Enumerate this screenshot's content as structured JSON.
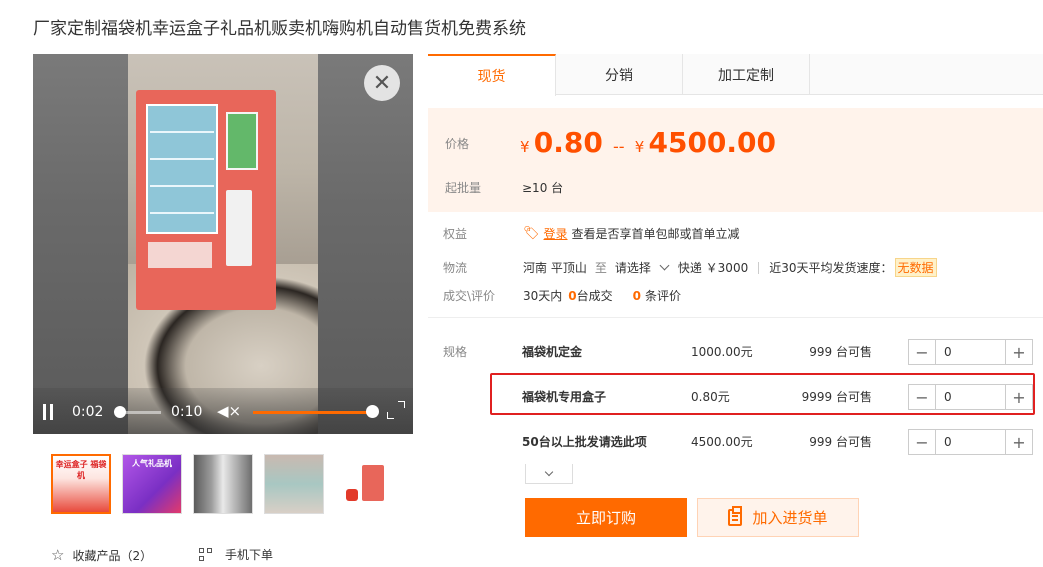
{
  "product_title": "厂家定制福袋机幸运盒子礼品机贩卖机嗨购机自动售货机免费系统",
  "video": {
    "current_time": "0:02",
    "duration": "0:10",
    "progress": 0.2,
    "volume": 1.0,
    "close_icon": "close-icon",
    "pause_icon": "pause-icon",
    "mute_icon": "volume-mute-icon",
    "fullscreen_icon": "fullscreen-icon"
  },
  "thumbnails": [
    {
      "text": "幸运盒子 福袋机",
      "color": "#e84a3c",
      "active": true
    },
    {
      "text": "人气礼品机",
      "color": "#9a3fd6",
      "active": false
    },
    {
      "text": "",
      "color": "#7d7d7d",
      "active": false
    },
    {
      "text": "",
      "color": "#b6a8a0",
      "active": false
    },
    {
      "text": "",
      "color": "#ffffff",
      "active": false
    }
  ],
  "bottom_links": {
    "favorite": "收藏产品（2）",
    "mobile_order": "手机下单"
  },
  "tabs": [
    {
      "label": "现货",
      "active": true
    },
    {
      "label": "分销",
      "active": false
    },
    {
      "label": "加工定制",
      "active": false
    }
  ],
  "price": {
    "label": "价格",
    "currency": "¥",
    "min": "0.80",
    "separator": "--",
    "max": "4500.00",
    "moq_label": "起批量",
    "moq_value": "≥10 台"
  },
  "rights": {
    "label": "权益",
    "login_link": "登录",
    "text": "查看是否享首单包邮或首单立减"
  },
  "logistics": {
    "label": "物流",
    "origin": "河南 平顶山",
    "to": "至",
    "destination": "请选择",
    "express": "快递 ￥3000",
    "speed_label": "近30天平均发货速度：",
    "speed_value": "无数据"
  },
  "deals": {
    "label": "成交\\评价",
    "prefix": "30天内",
    "sold_count": "0",
    "sold_suffix": "台成交",
    "review_count": "0",
    "review_suffix": "条评价"
  },
  "specs": {
    "label": "规格",
    "rows": [
      {
        "name": "福袋机定金",
        "price": "1000.00元",
        "stock": "999 台可售",
        "qty": "0"
      },
      {
        "name": "福袋机专用盒子",
        "price": "0.80元",
        "stock": "9999 台可售",
        "qty": "0"
      },
      {
        "name": "50台以上批发请选此项",
        "price": "4500.00元",
        "stock": "999 台可售",
        "qty": "0"
      }
    ]
  },
  "actions": {
    "buy_now": "立即订购",
    "add_to_cart": "加入进货单"
  },
  "colors": {
    "accent": "#ff6a00",
    "highlight_border": "#e02020",
    "price_bg": "#fff3eb"
  }
}
